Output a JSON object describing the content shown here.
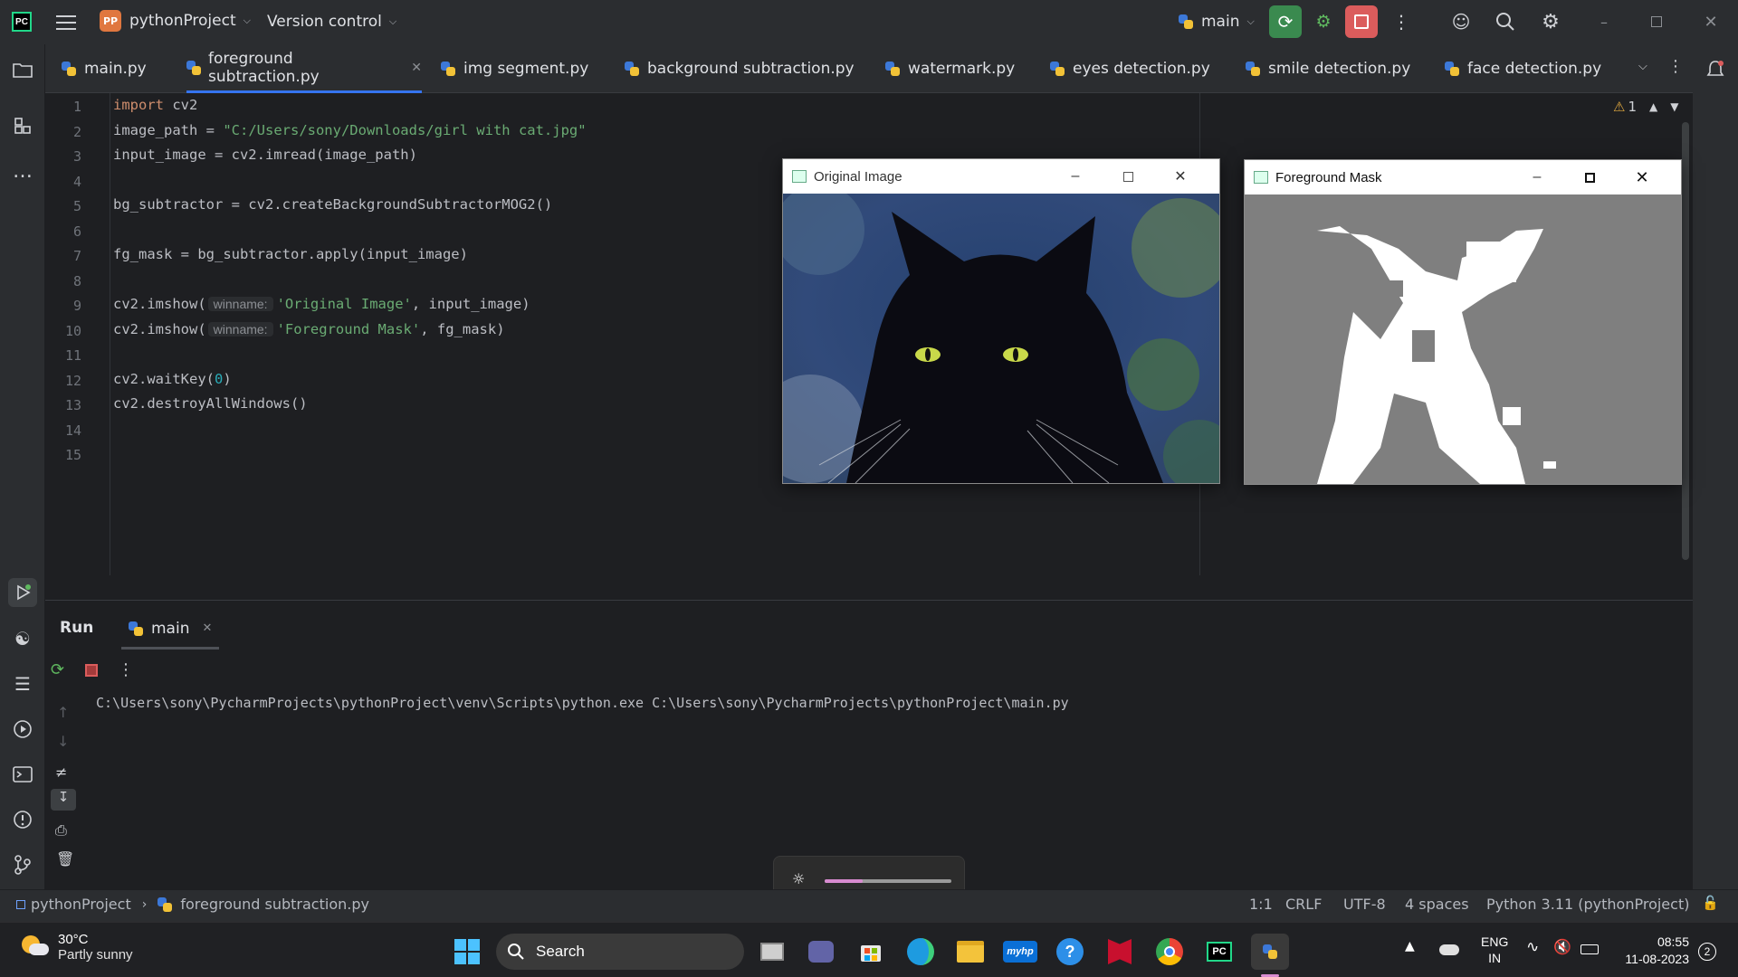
{
  "titlebar": {
    "project_badge": "PP",
    "project_name": "pythonProject",
    "vcs_label": "Version control",
    "run_config": "main"
  },
  "tabs": [
    {
      "label": "main.py"
    },
    {
      "label": "foreground subtraction.py"
    },
    {
      "label": "img segment.py"
    },
    {
      "label": "background subtraction.py"
    },
    {
      "label": "watermark.py"
    },
    {
      "label": "eyes detection.py"
    },
    {
      "label": "smile detection.py"
    },
    {
      "label": "face detection.py"
    }
  ],
  "editor": {
    "problems_count": "1",
    "line_numbers": [
      "1",
      "2",
      "3",
      "4",
      "5",
      "6",
      "7",
      "8",
      "9",
      "10",
      "11",
      "12",
      "13",
      "14",
      "15"
    ],
    "line1_kw": "import",
    "line1_rest": " cv2",
    "line2_a": "image_path = ",
    "line2_str": "\"C:/Users/sony/Downloads/girl with cat.jpg\"",
    "line3": "input_image = cv2.imread(image_path)",
    "line5": "bg_subtractor = cv2.createBackgroundSubtractorMOG2()",
    "line7": "fg_mask = bg_subtractor.apply(input_image)",
    "line9_a": "cv2.imshow(",
    "line9_hint": "winname:",
    "line9_str": "'Original Image'",
    "line9_b": ", input_image)",
    "line10_a": "cv2.imshow(",
    "line10_hint": "winname:",
    "line10_str": "'Foreground Mask'",
    "line10_b": ", fg_mask)",
    "line12_a": "cv2.waitKey(",
    "line12_num": "0",
    "line12_b": ")",
    "line13": "cv2.destroyAllWindows()"
  },
  "windows": {
    "original_title": "Original Image",
    "mask_title": "Foreground Mask"
  },
  "run": {
    "tab_run": "Run",
    "tab_main": "main",
    "console_line": "C:\\Users\\sony\\PycharmProjects\\pythonProject\\venv\\Scripts\\python.exe C:\\Users\\sony\\PycharmProjects\\pythonProject\\main.py"
  },
  "brightness_level": 0.3,
  "statusbar": {
    "breadcrumb_project": "pythonProject",
    "breadcrumb_file": "foreground subtraction.py",
    "position": "1:1",
    "line_sep": "CRLF",
    "encoding": "UTF-8",
    "indent": "4 spaces",
    "interpreter": "Python 3.11 (pythonProject)"
  },
  "taskbar": {
    "temp": "30°C",
    "weather": "Partly sunny",
    "search_label": "Search",
    "lang1": "ENG",
    "lang2": "IN",
    "time": "08:55",
    "date": "11-08-2023",
    "notif_count": "2",
    "pycharm_label": "PC",
    "myhp_label": "myhp"
  },
  "colors": {
    "accent": "#3574f0",
    "run_green": "#3a8a4f",
    "stop_red": "#db5c5c"
  }
}
